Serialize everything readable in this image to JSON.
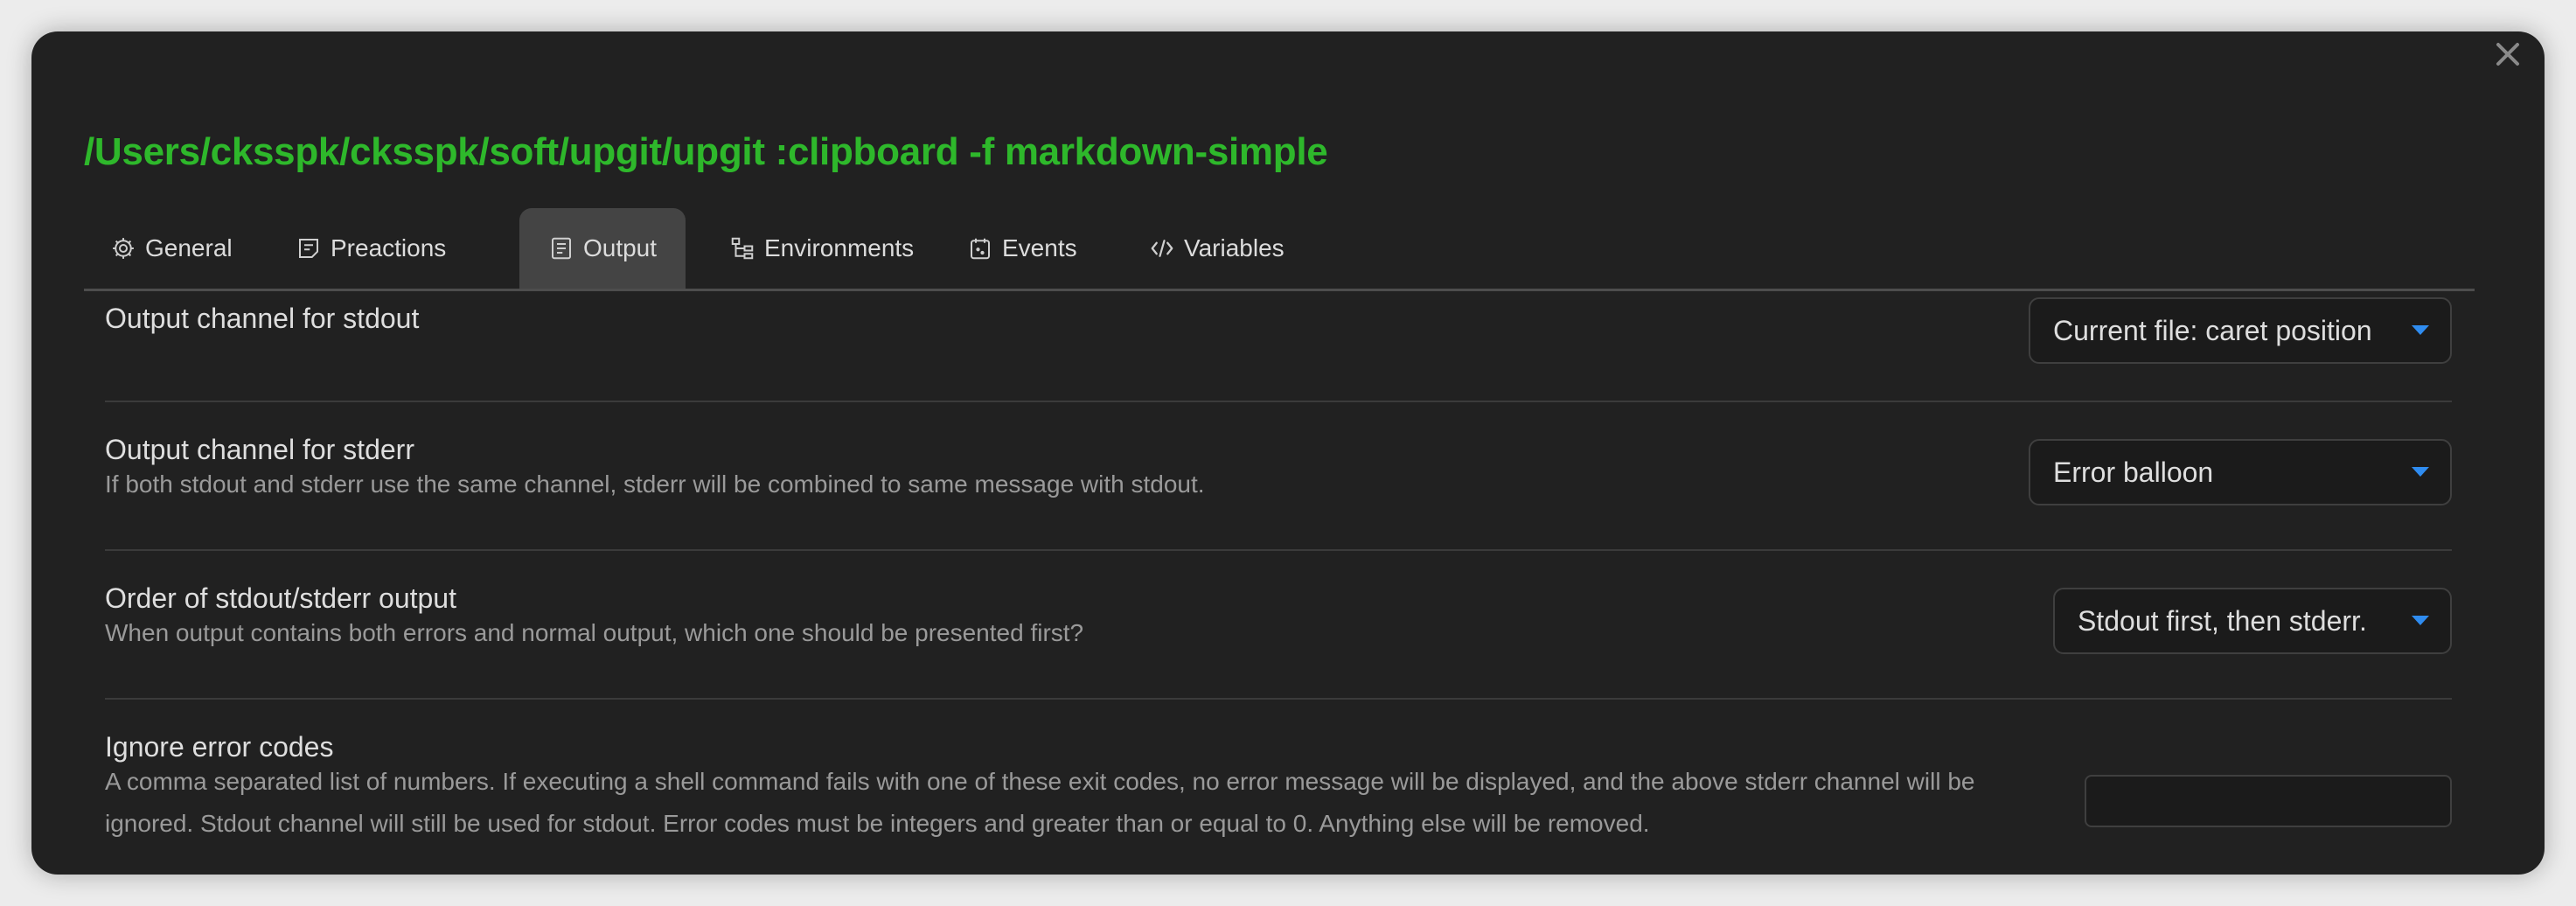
{
  "dialog": {
    "title": "/Users/cksspk/cksspk/soft/upgit/upgit :clipboard -f markdown-simple"
  },
  "tabs": [
    {
      "label": "General",
      "icon": "gear-icon"
    },
    {
      "label": "Preactions",
      "icon": "preactions-icon"
    },
    {
      "label": "Output",
      "icon": "document-lines-icon"
    },
    {
      "label": "Environments",
      "icon": "hierarchy-icon"
    },
    {
      "label": "Events",
      "icon": "calendar-icon"
    },
    {
      "label": "Variables",
      "icon": "code-icon"
    }
  ],
  "active_tab": "Output",
  "settings": {
    "stdout": {
      "title": "Output channel for stdout",
      "value": "Current file: caret position"
    },
    "stderr": {
      "title": "Output channel for stderr",
      "description": "If both stdout and stderr use the same channel, stderr will be combined to same message with stdout.",
      "value": "Error balloon"
    },
    "order": {
      "title": "Order of stdout/stderr output",
      "description": "When output contains both errors and normal output, which one should be presented first?",
      "value": "Stdout first, then stderr."
    },
    "ignore_codes": {
      "title": "Ignore error codes",
      "description": "A comma separated list of numbers. If executing a shell command fails with one of these exit codes, no error message will be displayed, and the above stderr channel will be ignored. Stdout channel will still be used for stdout. Error codes must be integers and greater than or equal to 0. Anything else will be removed.",
      "value": ""
    }
  },
  "colors": {
    "title": "#2eb82b",
    "dropdown_caret": "#2f8cf0"
  }
}
